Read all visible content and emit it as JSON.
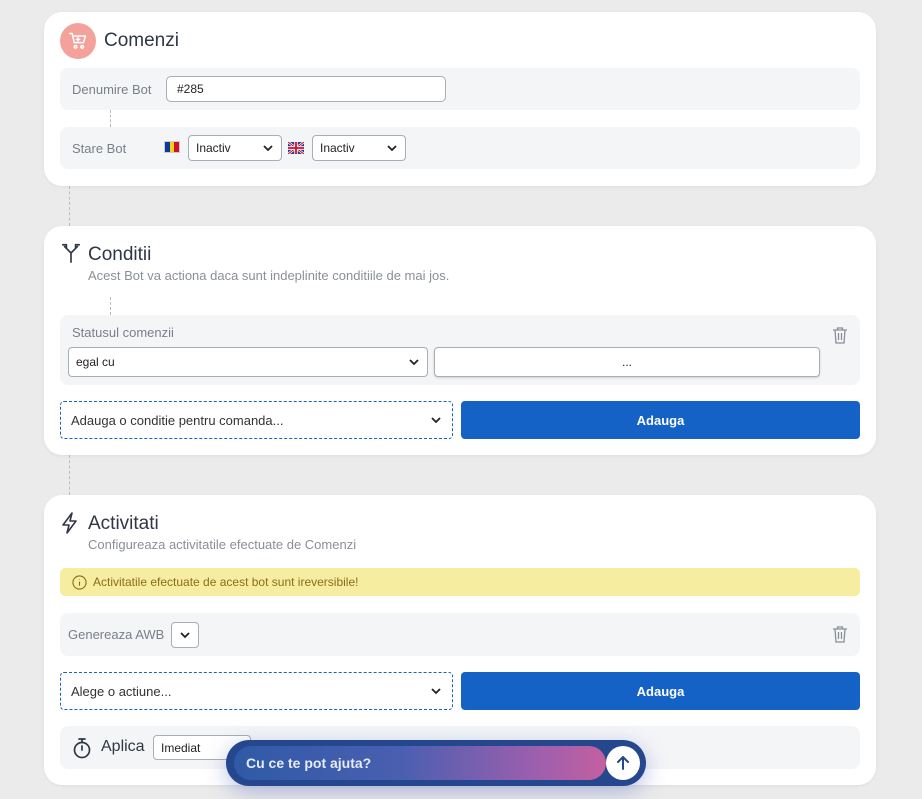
{
  "comenzi": {
    "title": "Comenzi",
    "bot_name_label": "Denumire Bot",
    "bot_name_value": "#285",
    "state_label": "Stare Bot",
    "state_ro": "Inactiv",
    "state_en": "Inactiv"
  },
  "conditii": {
    "title": "Conditii",
    "subtitle": "Acest Bot va actiona daca sunt indeplinite conditiile de mai jos.",
    "condition_label": "Statusul comenzii",
    "operator": "egal cu",
    "value": "...",
    "add_select": "Adauga o conditie pentru comanda...",
    "add_button": "Adauga"
  },
  "activitati": {
    "title": "Activitati",
    "subtitle": "Configureaza activitatile efectuate de Comenzi",
    "warning": "Activitatile efectuate de acest bot sunt ireversibile!",
    "activity_label": "Genereaza AWB",
    "action_select": "Alege o actiune...",
    "add_button": "Adauga",
    "apply_label": "Aplica",
    "apply_value": "Imediat"
  },
  "chat": {
    "placeholder": "Cu ce te pot ajuta?"
  },
  "colors": {
    "accent": "#1562c6",
    "cart_icon_bg": "#f4a19c",
    "warning_bg": "#f7eda1",
    "warning_text": "#8a6d1a"
  }
}
